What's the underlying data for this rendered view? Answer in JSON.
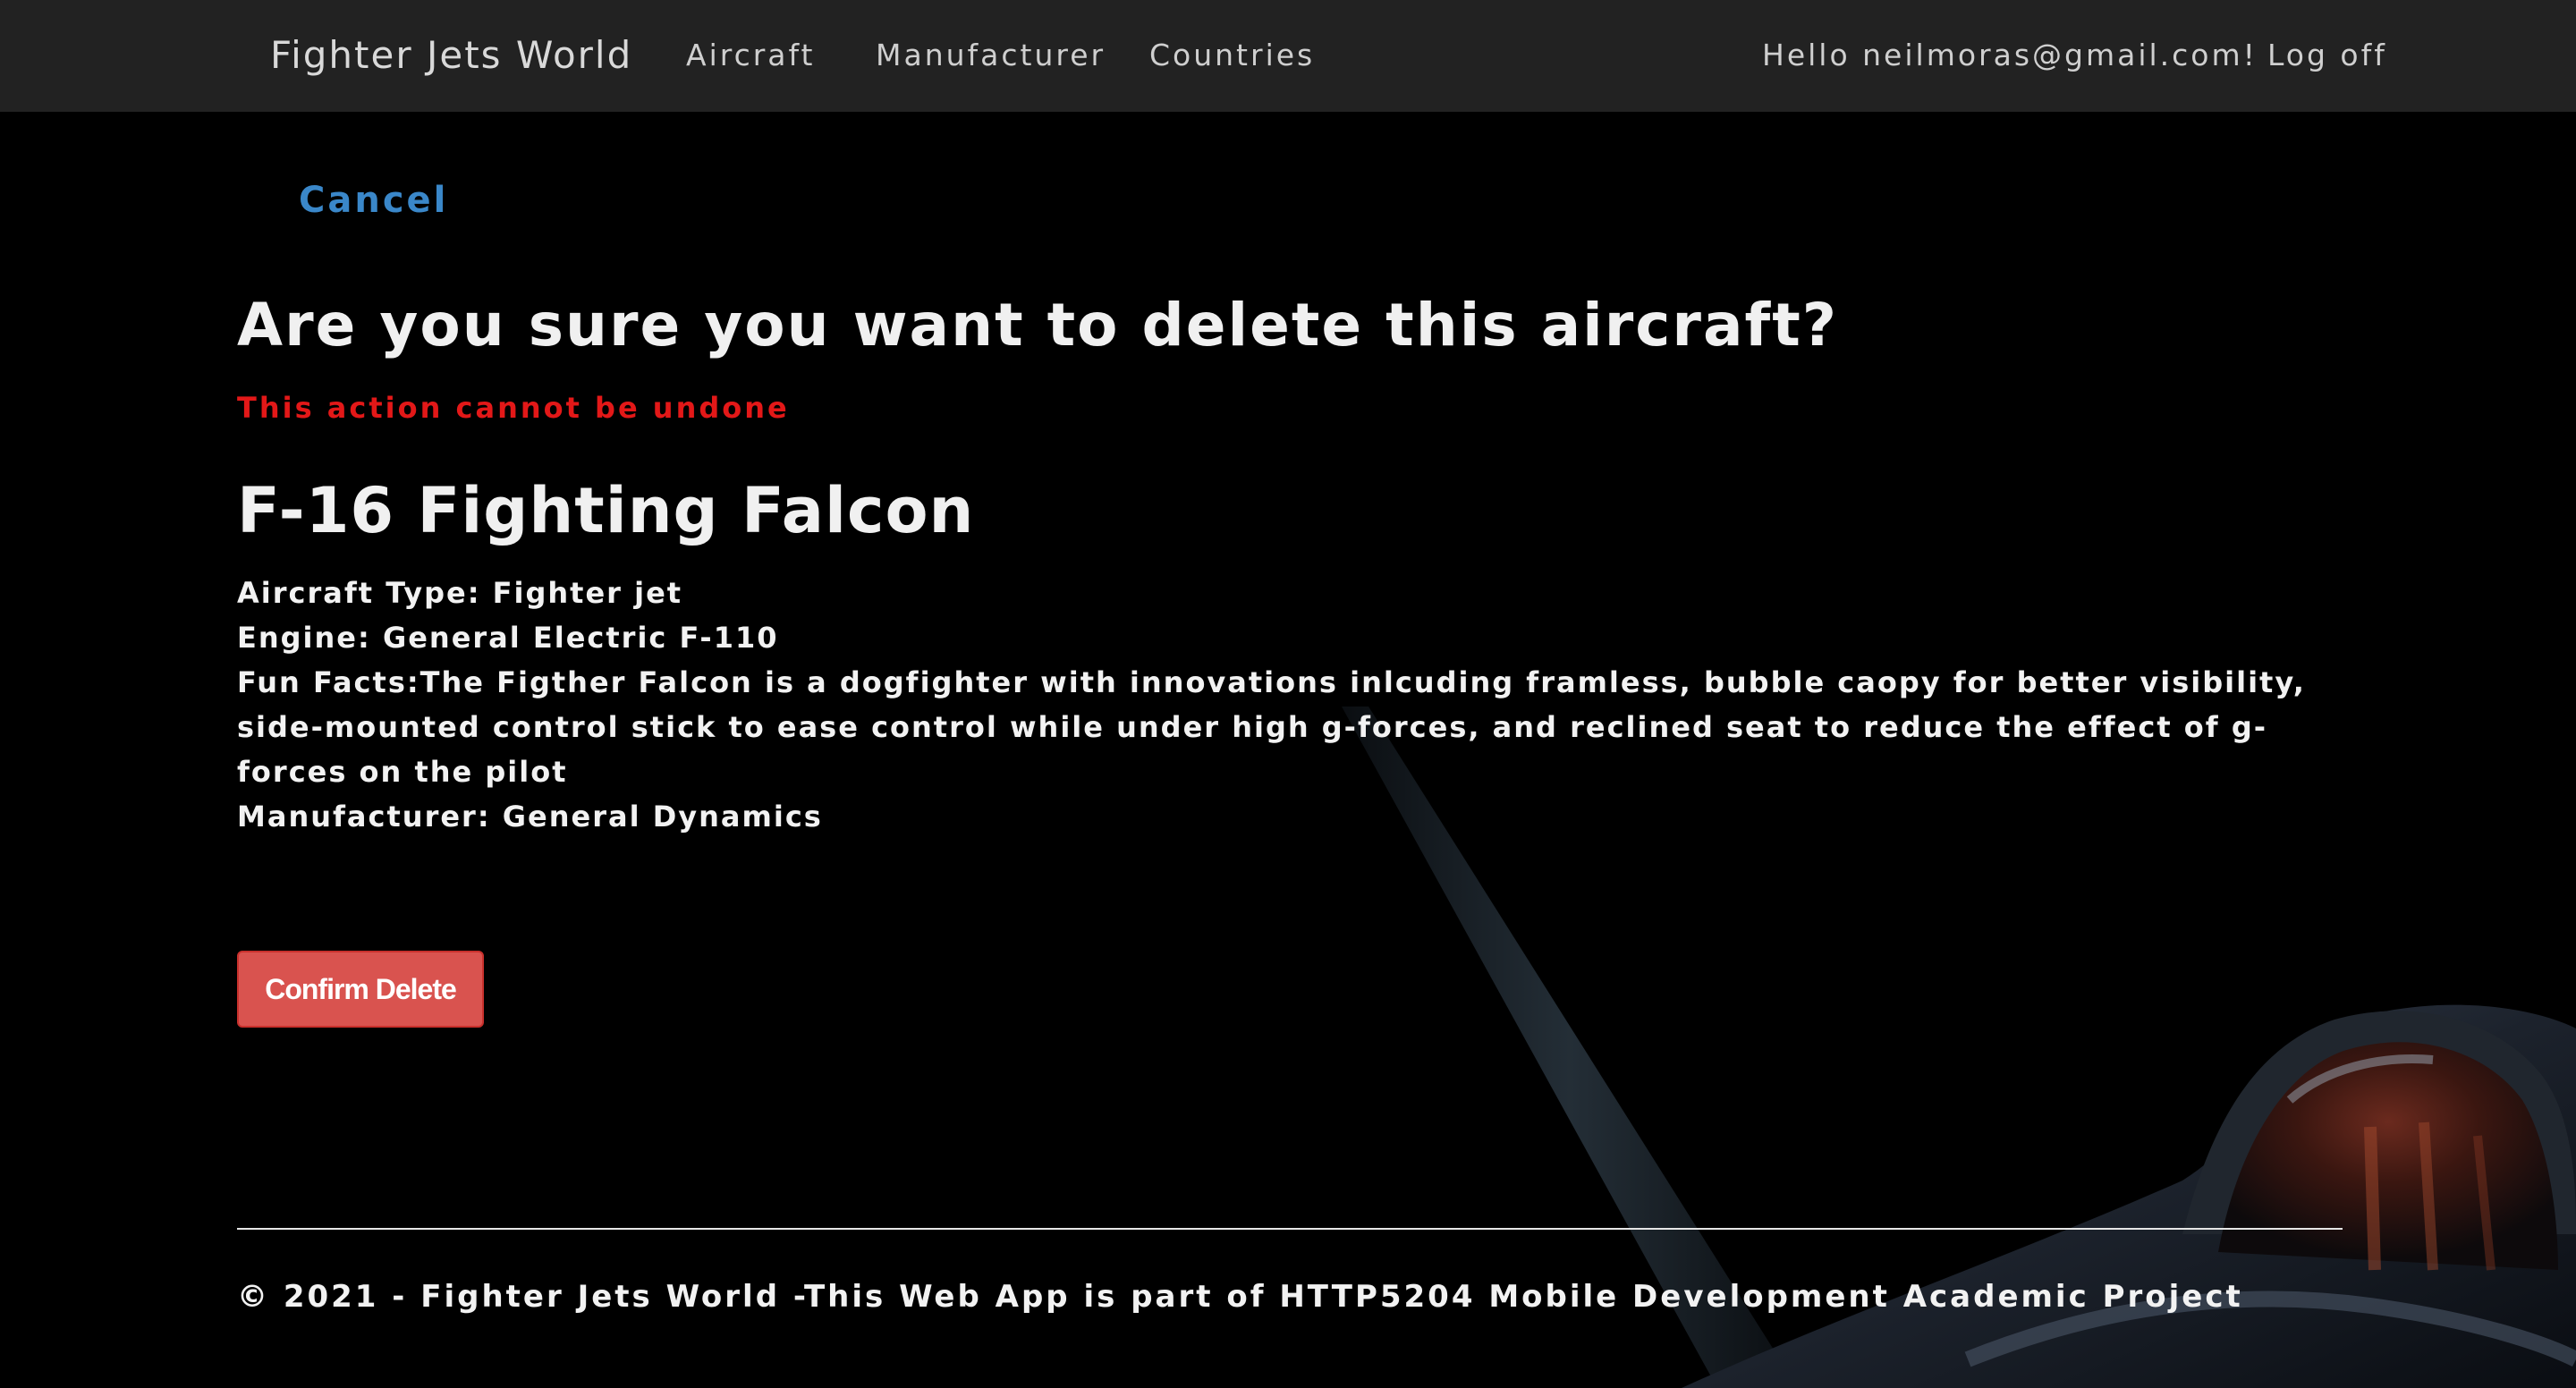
{
  "navbar": {
    "brand": "Fighter Jets World",
    "links": {
      "aircraft": "Aircraft",
      "manufacturer": "Manufacturer",
      "countries": "Countries"
    },
    "greeting": "Hello neilmoras@gmail.com!",
    "logoff": "Log off"
  },
  "main": {
    "cancel_label": "Cancel",
    "heading": "Are you sure you want to delete this aircraft?",
    "warning": "This action cannot be undone",
    "aircraft": {
      "name": "F-16 Fighting Falcon",
      "type_line": "Aircraft Type: Fighter jet",
      "engine_line": "Engine: General Electric F-110",
      "fun_facts_line": "Fun Facts:The Figther Falcon is a dogfighter with innovations inlcuding framless, bubble caopy for better visibility, side-mounted control stick to ease control while under high g-forces, and reclined seat to reduce the effect of g-forces on the pilot",
      "manufacturer_line": "Manufacturer: General Dynamics"
    },
    "confirm_label": "Confirm Delete"
  },
  "footer": {
    "text": "© 2021 - Fighter Jets World -This Web App is part of HTTP5204 Mobile Development Academic Project"
  },
  "colors": {
    "navbar_bg": "#222222",
    "page_bg": "#000000",
    "link_blue": "#3a87c9",
    "warning_red": "#e31818",
    "danger_button": "#d9534f"
  },
  "icons": {
    "background": "fighter-jet-cockpit-image"
  }
}
